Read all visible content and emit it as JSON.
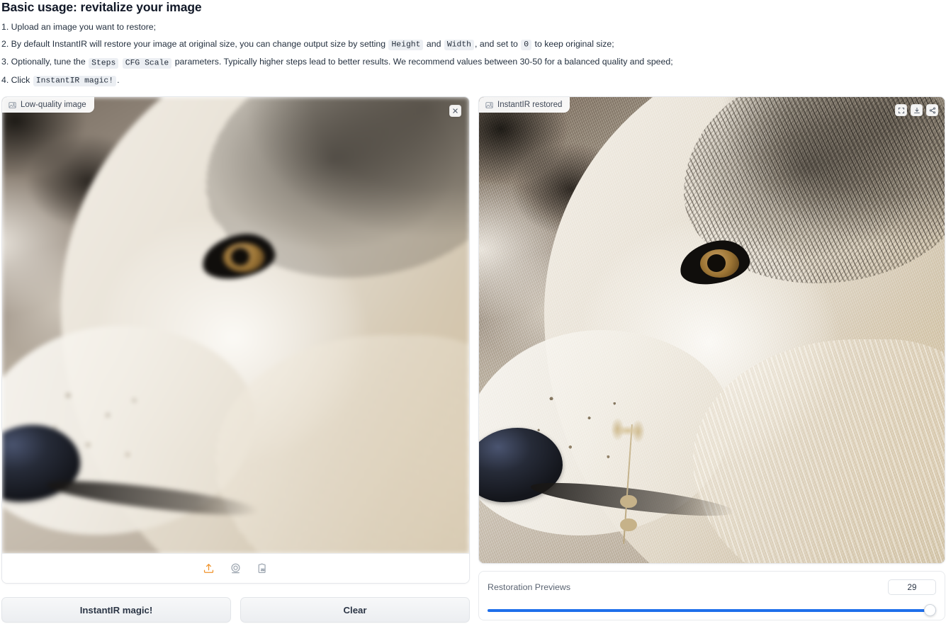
{
  "usage": {
    "title": "Basic usage: revitalize your image",
    "steps": [
      {
        "id": 1,
        "parts": [
          {
            "t": "text",
            "v": "1. Upload an image you want to restore;"
          }
        ]
      },
      {
        "id": 2,
        "parts": [
          {
            "t": "text",
            "v": "2. By default InstantIR will restore your image at original size, you can change output size by setting "
          },
          {
            "t": "code",
            "v": "Height"
          },
          {
            "t": "text",
            "v": " and "
          },
          {
            "t": "code",
            "v": "Width"
          },
          {
            "t": "text",
            "v": ", and set to "
          },
          {
            "t": "code",
            "v": "0"
          },
          {
            "t": "text",
            "v": " to keep original size;"
          }
        ]
      },
      {
        "id": 3,
        "parts": [
          {
            "t": "text",
            "v": "3. Optionally, tune the "
          },
          {
            "t": "code",
            "v": "Steps"
          },
          {
            "t": "text",
            "v": " "
          },
          {
            "t": "code",
            "v": "CFG Scale"
          },
          {
            "t": "text",
            "v": " parameters. Typically higher steps lead to better results. We recommend values between 30-50 for a balanced quality and speed;"
          }
        ]
      },
      {
        "id": 4,
        "parts": [
          {
            "t": "text",
            "v": "4. Click "
          },
          {
            "t": "code",
            "v": "InstantIR magic!"
          },
          {
            "t": "text",
            "v": "."
          }
        ]
      }
    ]
  },
  "input_panel": {
    "label": "Low-quality image",
    "label_icon": "image-icon",
    "close_button": "close-icon",
    "image_alt": "Blurry low-quality close-up photo of a white wolf in profile",
    "toolbar": [
      {
        "name": "upload-icon",
        "label": "Upload"
      },
      {
        "name": "webcam-icon",
        "label": "Webcam"
      },
      {
        "name": "paste-clipboard-icon",
        "label": "Paste from clipboard"
      }
    ]
  },
  "output_panel": {
    "label": "InstantIR restored",
    "label_icon": "image-icon",
    "image_alt": "Sharp restored close-up photo of a white wolf in profile with a dried flower",
    "tools": [
      {
        "name": "fullscreen-icon",
        "label": "Fullscreen"
      },
      {
        "name": "download-icon",
        "label": "Download"
      },
      {
        "name": "share-icon",
        "label": "Share"
      }
    ]
  },
  "actions": {
    "primary_label": "InstantIR magic!",
    "secondary_label": "Clear"
  },
  "slider": {
    "label": "Restoration Previews",
    "value": "29",
    "min": 0,
    "max": 29,
    "fill_percent": 100
  },
  "colors": {
    "accent": "#1f6feb",
    "upload_icon": "#f0932b",
    "text": "#24303f",
    "panel_border": "#e5e7eb",
    "code_bg": "#eceff3"
  }
}
